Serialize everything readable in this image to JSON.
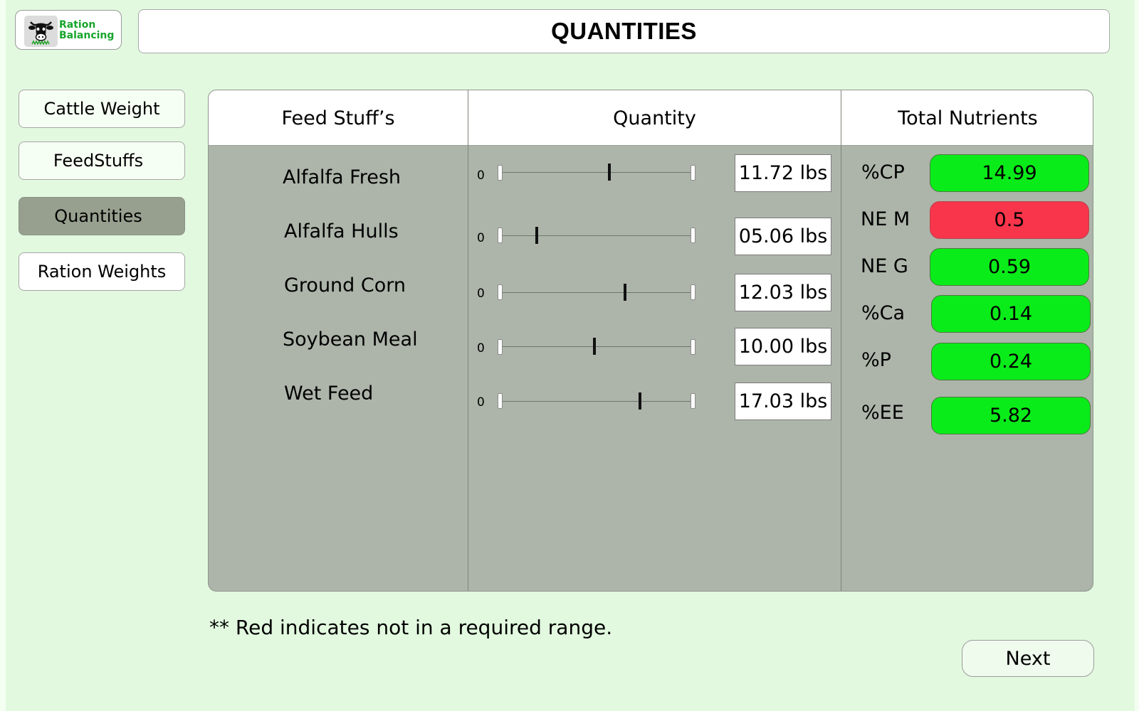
{
  "app": {
    "logo_line1": "Ration",
    "logo_line2": "Balancing",
    "title": "QUANTITIES"
  },
  "nav": {
    "cattle_weight": "Cattle Weight",
    "feedstuffs": "FeedStuffs",
    "quantities": "Quantities",
    "ration_weights": "Ration Weights"
  },
  "table": {
    "headers": [
      "Feed Stuff’s",
      "Quantity",
      "Total Nutrients"
    ],
    "rows": [
      {
        "name": "Alfalfa Fresh",
        "slider_min": "0",
        "slider_fraction": 0.57,
        "quantity": "11.72 lbs"
      },
      {
        "name": "Alfalfa Hulls",
        "slider_min": "0",
        "slider_fraction": 0.18,
        "quantity": "05.06 lbs"
      },
      {
        "name": "Ground Corn",
        "slider_min": "0",
        "slider_fraction": 0.65,
        "quantity": "12.03 lbs"
      },
      {
        "name": "Soybean Meal",
        "slider_min": "0",
        "slider_fraction": 0.49,
        "quantity": "10.00 lbs"
      },
      {
        "name": "Wet Feed",
        "slider_min": "0",
        "slider_fraction": 0.73,
        "quantity": "17.03 lbs"
      }
    ]
  },
  "nutrients": [
    {
      "label": "%CP",
      "value": "14.99",
      "status": "ok"
    },
    {
      "label": "NE M",
      "value": "0.5",
      "status": "out-of-range"
    },
    {
      "label": "NE G",
      "value": "0.59",
      "status": "ok"
    },
    {
      "label": "%Ca",
      "value": "0.14",
      "status": "ok"
    },
    {
      "label": "%P",
      "value": "0.24",
      "status": "ok"
    },
    {
      "label": "%EE",
      "value": "5.82",
      "status": "ok"
    }
  ],
  "colors": {
    "ok": "#0aec19",
    "out_of_range": "#f8354a",
    "background": "#e2f9df",
    "panel": "#adb5aa",
    "active_nav": "#97a08f"
  },
  "icons": {
    "logo": "cow-icon"
  },
  "footer": {
    "note": "** Red indicates not in a required range.",
    "next_label": "Next"
  }
}
